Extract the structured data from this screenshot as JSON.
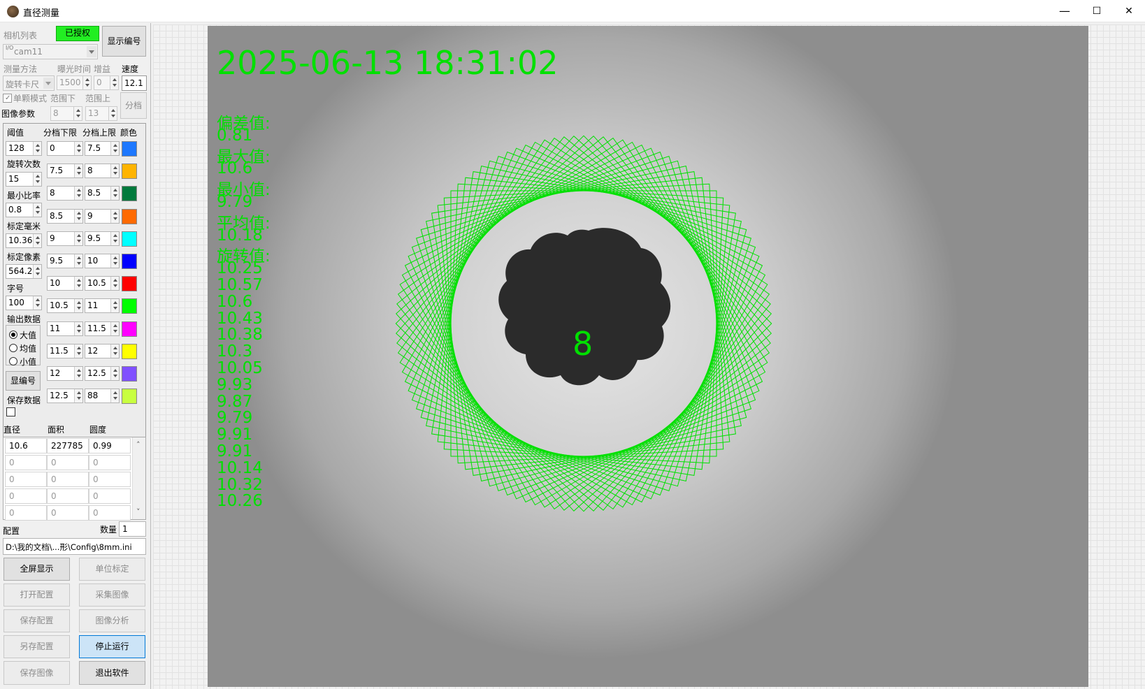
{
  "window": {
    "title": "直径测量",
    "minimize": "—",
    "maximize": "☐",
    "close": "✕"
  },
  "camera": {
    "list_label": "相机列表",
    "authorized": "已授权",
    "show_number": "显示编号",
    "prefix": "I/O",
    "selected": "cam11"
  },
  "measure": {
    "method_label": "测量方法",
    "exposure_label": "曝光时间",
    "gain_label": "增益",
    "speed_label": "速度",
    "method": "旋转卡尺",
    "exposure": "1500",
    "gain": "0",
    "speed": "12.1",
    "single_mode": "单颗模式",
    "range_low_label": "范围下",
    "range_high_label": "范围上",
    "range_low": "8",
    "range_high": "13",
    "grade_button": "分档",
    "image_params": "图像参数"
  },
  "params": {
    "threshold_label": "阈值",
    "threshold": "128",
    "rotation_label": "旋转次数",
    "rotation": "15",
    "min_ratio_label": "最小比率",
    "min_ratio": "0.8",
    "calib_mm_label": "标定毫米",
    "calib_mm": "10.36",
    "calib_px_label": "标定像素",
    "calib_px": "564.2",
    "font_label": "字号",
    "font": "100",
    "output_label": "输出数据",
    "out_max": "大值",
    "out_avg": "均值",
    "out_min": "小值",
    "show_id_button": "显编号",
    "save_data_label": "保存数据"
  },
  "grades": {
    "header_low": "分档下限",
    "header_high": "分档上限",
    "header_color": "颜色",
    "rows": [
      {
        "low": "0",
        "high": "7.5",
        "color": "#1e78ff"
      },
      {
        "low": "7.5",
        "high": "8",
        "color": "#ffb400"
      },
      {
        "low": "8",
        "high": "8.5",
        "color": "#007a3c"
      },
      {
        "low": "8.5",
        "high": "9",
        "color": "#ff6a00"
      },
      {
        "low": "9",
        "high": "9.5",
        "color": "#00ffff"
      },
      {
        "low": "9.5",
        "high": "10",
        "color": "#0000ff"
      },
      {
        "low": "10",
        "high": "10.5",
        "color": "#ff0000"
      },
      {
        "low": "10.5",
        "high": "11",
        "color": "#00ff00"
      },
      {
        "low": "11",
        "high": "11.5",
        "color": "#ff00ff"
      },
      {
        "low": "11.5",
        "high": "12",
        "color": "#ffff00"
      },
      {
        "low": "12",
        "high": "12.5",
        "color": "#8050ff"
      },
      {
        "low": "12.5",
        "high": "88",
        "color": "#c8ff40"
      }
    ]
  },
  "results": {
    "col_diameter": "直径",
    "col_area": "面积",
    "col_roundness": "圆度",
    "rows": [
      [
        "10.6",
        "227785",
        "0.99"
      ],
      [
        "0",
        "0",
        "0"
      ],
      [
        "0",
        "0",
        "0"
      ],
      [
        "0",
        "0",
        "0"
      ],
      [
        "0",
        "0",
        "0"
      ]
    ]
  },
  "config": {
    "label": "配置",
    "count_label": "数量",
    "count": "1",
    "path": "D:\\我的文档\\...形\\Config\\8mm.ini"
  },
  "buttons": {
    "fullscreen": "全屏显示",
    "unit_calib": "单位标定",
    "open_config": "打开配置",
    "capture": "采集图像",
    "save_config": "保存配置",
    "analyze": "图像分析",
    "save_as": "另存配置",
    "stop": "停止运行",
    "save_image": "保存图像",
    "exit": "退出软件"
  },
  "overlay": {
    "timestamp": "2025-06-13 18:31:02",
    "center_label": "8",
    "lines": [
      "偏差值:",
      "0.81",
      "最大值:",
      "10.6",
      "最小值:",
      "9.79",
      "平均值:",
      "10.18",
      "旋转值:",
      "10.25",
      "10.57",
      "10.6",
      "10.43",
      "10.38",
      "10.3",
      "10.05",
      "9.93",
      "9.87",
      "9.79",
      "9.91",
      "9.91",
      "10.14",
      "10.32",
      "10.26"
    ],
    "overlay_color": "#00e000"
  }
}
